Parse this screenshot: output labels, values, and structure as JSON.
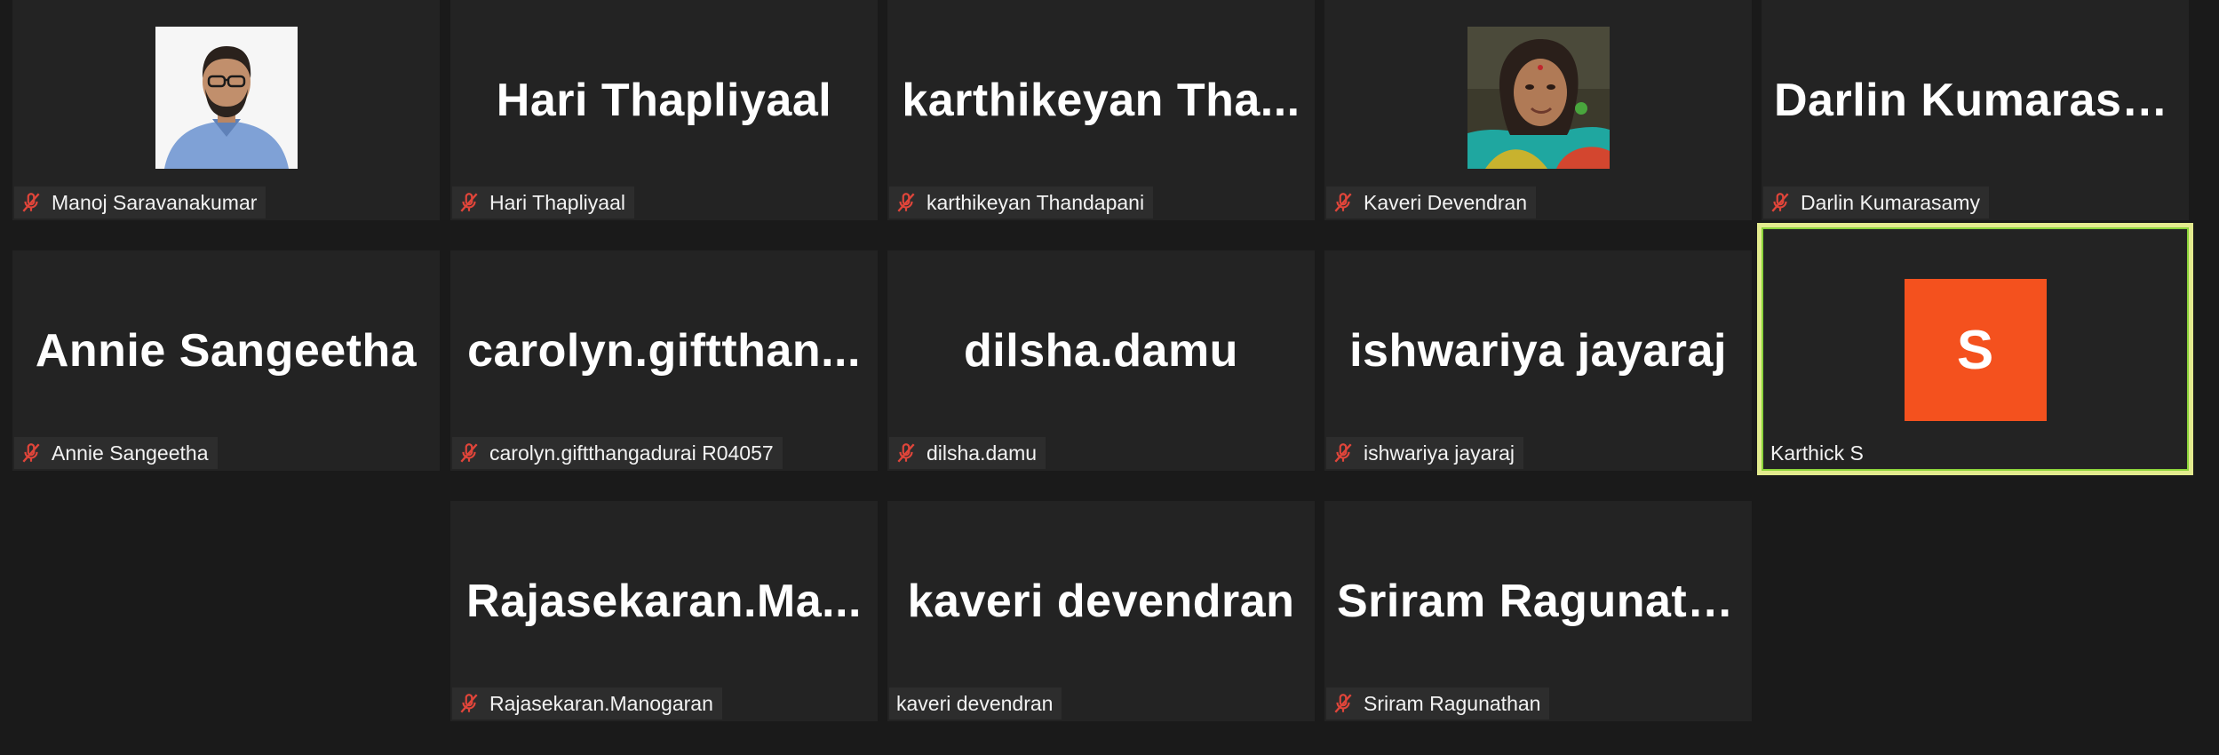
{
  "participants": [
    {
      "display": "photo",
      "photo": "man-glasses-blue-shirt",
      "name": "Manoj Saravanakumar",
      "muted": true
    },
    {
      "display": "text",
      "big_name": "Hari Thapliyaal",
      "name": "Hari Thapliyaal",
      "muted": true
    },
    {
      "display": "text",
      "big_name": "karthikeyan Tha...",
      "name": "karthikeyan Thandapani",
      "muted": true
    },
    {
      "display": "photo",
      "photo": "woman-saree-bindi",
      "name": "Kaveri Devendran",
      "muted": true
    },
    {
      "display": "text",
      "big_name": "Darlin Kumarasa...",
      "name": "Darlin Kumarasamy",
      "muted": true
    },
    {
      "display": "text",
      "big_name": "Annie Sangeetha",
      "name": "Annie Sangeetha",
      "muted": true
    },
    {
      "display": "text",
      "big_name": "carolyn.giftthan...",
      "name": "carolyn.giftthangadurai R04057",
      "muted": true
    },
    {
      "display": "text",
      "big_name": "dilsha.damu",
      "name": "dilsha.damu",
      "muted": true
    },
    {
      "display": "text",
      "big_name": "ishwariya jayaraj",
      "name": "ishwariya jayaraj",
      "muted": true
    },
    {
      "display": "avatar",
      "initial": "S",
      "avatar_color": "#f4511e",
      "name": "Karthick S",
      "muted": false,
      "active_speaker": true
    },
    {
      "display": "text",
      "big_name": "Rajasekaran.Ma...",
      "name": "Rajasekaran.Manogaran",
      "muted": true
    },
    {
      "display": "text",
      "big_name": "kaveri devendran",
      "name": "kaveri devendran",
      "muted": false
    },
    {
      "display": "text",
      "big_name": "Sriram Ragunath...",
      "name": "Sriram Ragunathan",
      "muted": true
    }
  ],
  "icons": {
    "mute": "microphone-off-icon"
  },
  "colors": {
    "background": "#1a1a1a",
    "tile": "#232323",
    "label_bg": "#2d2d2d",
    "mute_red": "#e0453a",
    "active_border": "#e3eb8e",
    "active_glow": "#8bd33a"
  }
}
